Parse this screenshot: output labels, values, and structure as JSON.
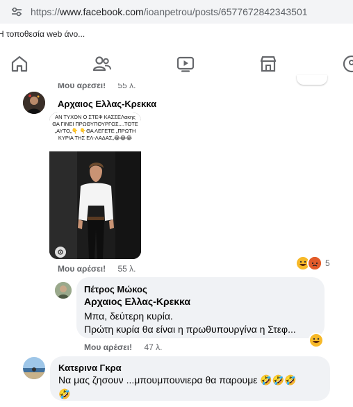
{
  "browser": {
    "url_scheme": "https://",
    "url_host": "www.facebook.com",
    "url_path": "/ioanpetrou/posts/6577672842343501",
    "bookmark": "Η τοποθεσία web άνο..."
  },
  "nav": {
    "icons": [
      "home-icon",
      "friends-icon",
      "video-icon",
      "marketplace-icon",
      "groups-icon"
    ]
  },
  "comments": {
    "top_partial": {
      "like": "Μου αρέσει!",
      "time": "55 λ."
    },
    "c1": {
      "author": "Αρχαιος Ελλας-Κρεκκα",
      "photo_caption": "ΑΝ ΤΥΧΟΝ Ο ΣΤΕΦ ΚΑΣΣΕΛακης ΘΑ ΓΙΝΕΙ ΠΡΩΘΥΠΟΥΡΓΟΣ....ΤΟΤΕ „ΑΥΤΟ„👇 👇ΘΑ ΛΕΓΕΤΕ „ΠΡΩΤΗ ΚΥΡΙΑ ΤΗΣ ΕΛ-ΛΑΔΑΣ„😂😂😂",
      "like": "Μου αρέσει!",
      "time": "55 λ.",
      "reaction_count": "5"
    },
    "c2": {
      "author": "Πέτρος Μώκος",
      "mention": "Αρχαιος Ελλας-Κρεκκα",
      "line1": "Μπα, δεύτερη κυρία.",
      "line2": "Πρώτη κυρία θα είναι η πρωθυπουργίνα η Στεφ...",
      "like": "Μου αρέσει!",
      "time": "47 λ."
    },
    "c3": {
      "author": "Κατερινα Γκρα",
      "line1": "Να μας ζησουν ...μπουμπουνιερα θα παρουμε 🤣🤣🤣",
      "line2": "🤣"
    }
  },
  "colors": {
    "accent": "#1877f2",
    "bubble": "#f0f2f5",
    "muted": "#65676b"
  }
}
